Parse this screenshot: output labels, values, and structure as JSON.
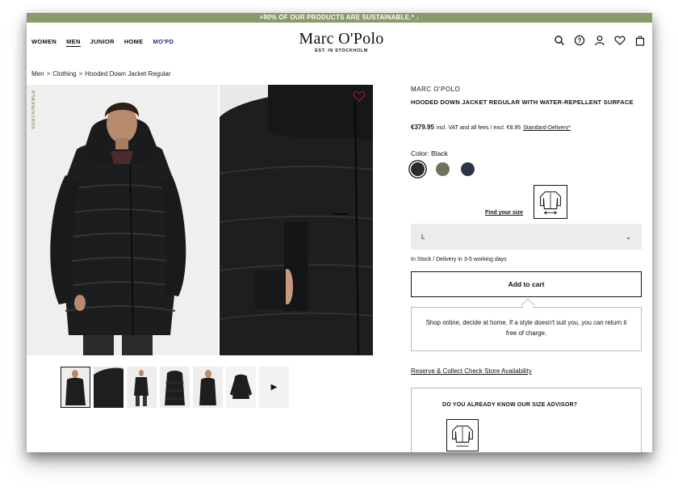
{
  "promo": {
    "text": "+90% OF OUR PRODUCTS ARE SUSTAINABLE.* ↓"
  },
  "nav": {
    "items": [
      "WOMEN",
      "MEN",
      "JUNIOR",
      "HOME",
      "MO'PD"
    ],
    "active": "MEN"
  },
  "logo": {
    "name": "Marc O'Polo",
    "tagline": "EST. IN STOCKHOLM"
  },
  "header_icons": [
    "search-icon",
    "help-icon",
    "account-icon",
    "wishlist-heart-icon",
    "shopping-bag-icon"
  ],
  "breadcrumb": {
    "items": [
      "Men",
      "Clothing",
      "Hooded Down Jacket Regular"
    ],
    "separator": ">"
  },
  "gallery": {
    "badge": "SUSTAINABLE",
    "badge_color": "#8a9a6b",
    "next_label": "▶"
  },
  "product": {
    "brand": "MARC O'POLO",
    "title": "HOODED DOWN JACKET REGULAR WITH WATER-REPELLENT SURFACE",
    "price": "€379.95",
    "price_note": "incl. VAT and all fees / excl. €8.95",
    "delivery_link": "Standard-Delivery*",
    "color_label": "Color: Black",
    "swatches": [
      {
        "color": "#2b2b2d",
        "selected": true
      },
      {
        "color": "#6d735c",
        "selected": false
      },
      {
        "color": "#2c3448",
        "selected": false
      }
    ],
    "find_size": "Find your size",
    "size_selected": "L",
    "size_chevron": "⌄",
    "stock": "In Stock /  Delivery in 3-5 working days",
    "add_to_cart": "Add to cart",
    "note": "Shop online, decide at home. If a style doesn't suit you, you can return it free of charge.",
    "reserve": "Reserve & Collect Check Store Availability",
    "advisor_title": "DO YOU ALREADY KNOW OUR SIZE ADVISOR?"
  },
  "colors": {
    "accent_green": "#8a9a6b",
    "mopd_blue": "#1f2f8a"
  }
}
